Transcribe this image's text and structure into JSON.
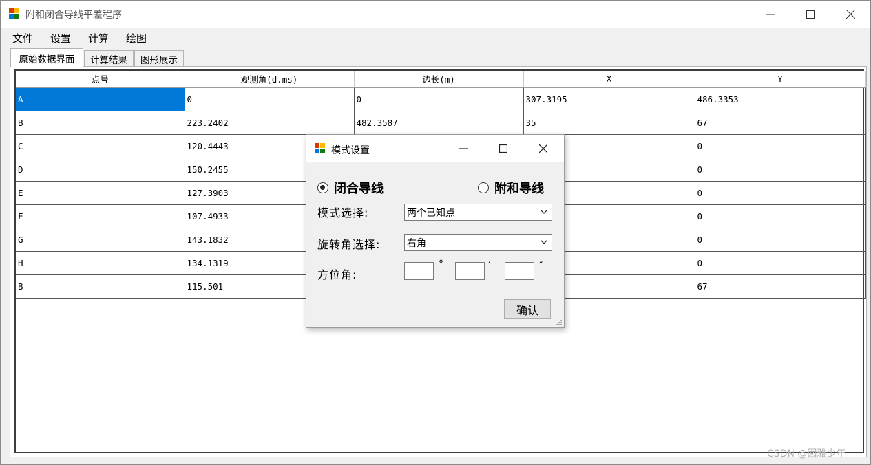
{
  "window": {
    "title": "附和闭合导线平差程序",
    "minimize_icon": "minimize-icon",
    "maximize_icon": "maximize-icon",
    "close_icon": "close-icon"
  },
  "menu": [
    "文件",
    "设置",
    "计算",
    "绘图"
  ],
  "tabs": [
    "原始数据界面",
    "计算结果",
    "图形展示"
  ],
  "table": {
    "headers": [
      "点号",
      "观测角(d.ms)",
      "边长(m)",
      "X",
      "Y"
    ],
    "rows": [
      [
        "A",
        "0",
        "0",
        "307.3195",
        "486.3353"
      ],
      [
        "B",
        "223.2402",
        "482.3587",
        "35",
        "67"
      ],
      [
        "C",
        "120.4443",
        "",
        "",
        "0"
      ],
      [
        "D",
        "150.2455",
        "",
        "",
        "0"
      ],
      [
        "E",
        "127.3903",
        "",
        "",
        "0"
      ],
      [
        "F",
        "107.4933",
        "",
        "",
        "0"
      ],
      [
        "G",
        "143.1832",
        "",
        "",
        "0"
      ],
      [
        "H",
        "134.1319",
        "",
        "",
        "0"
      ],
      [
        "B",
        "115.501",
        "",
        "",
        "67"
      ]
    ]
  },
  "dialog": {
    "title": "模式设置",
    "radio_closed": "闭合导线",
    "radio_attached": "附和导线",
    "mode_label": "模式选择:",
    "mode_value": "两个已知点",
    "rotation_label": "旋转角选择:",
    "rotation_value": "右角",
    "azimuth_label": "方位角:",
    "deg_unit": "°",
    "min_unit": "′",
    "sec_unit": "″",
    "confirm": "确认"
  },
  "watermark": "CSDN @囡雅少年",
  "colors": {
    "selection": "#0078d7",
    "window_bg": "#f0f0f0"
  }
}
